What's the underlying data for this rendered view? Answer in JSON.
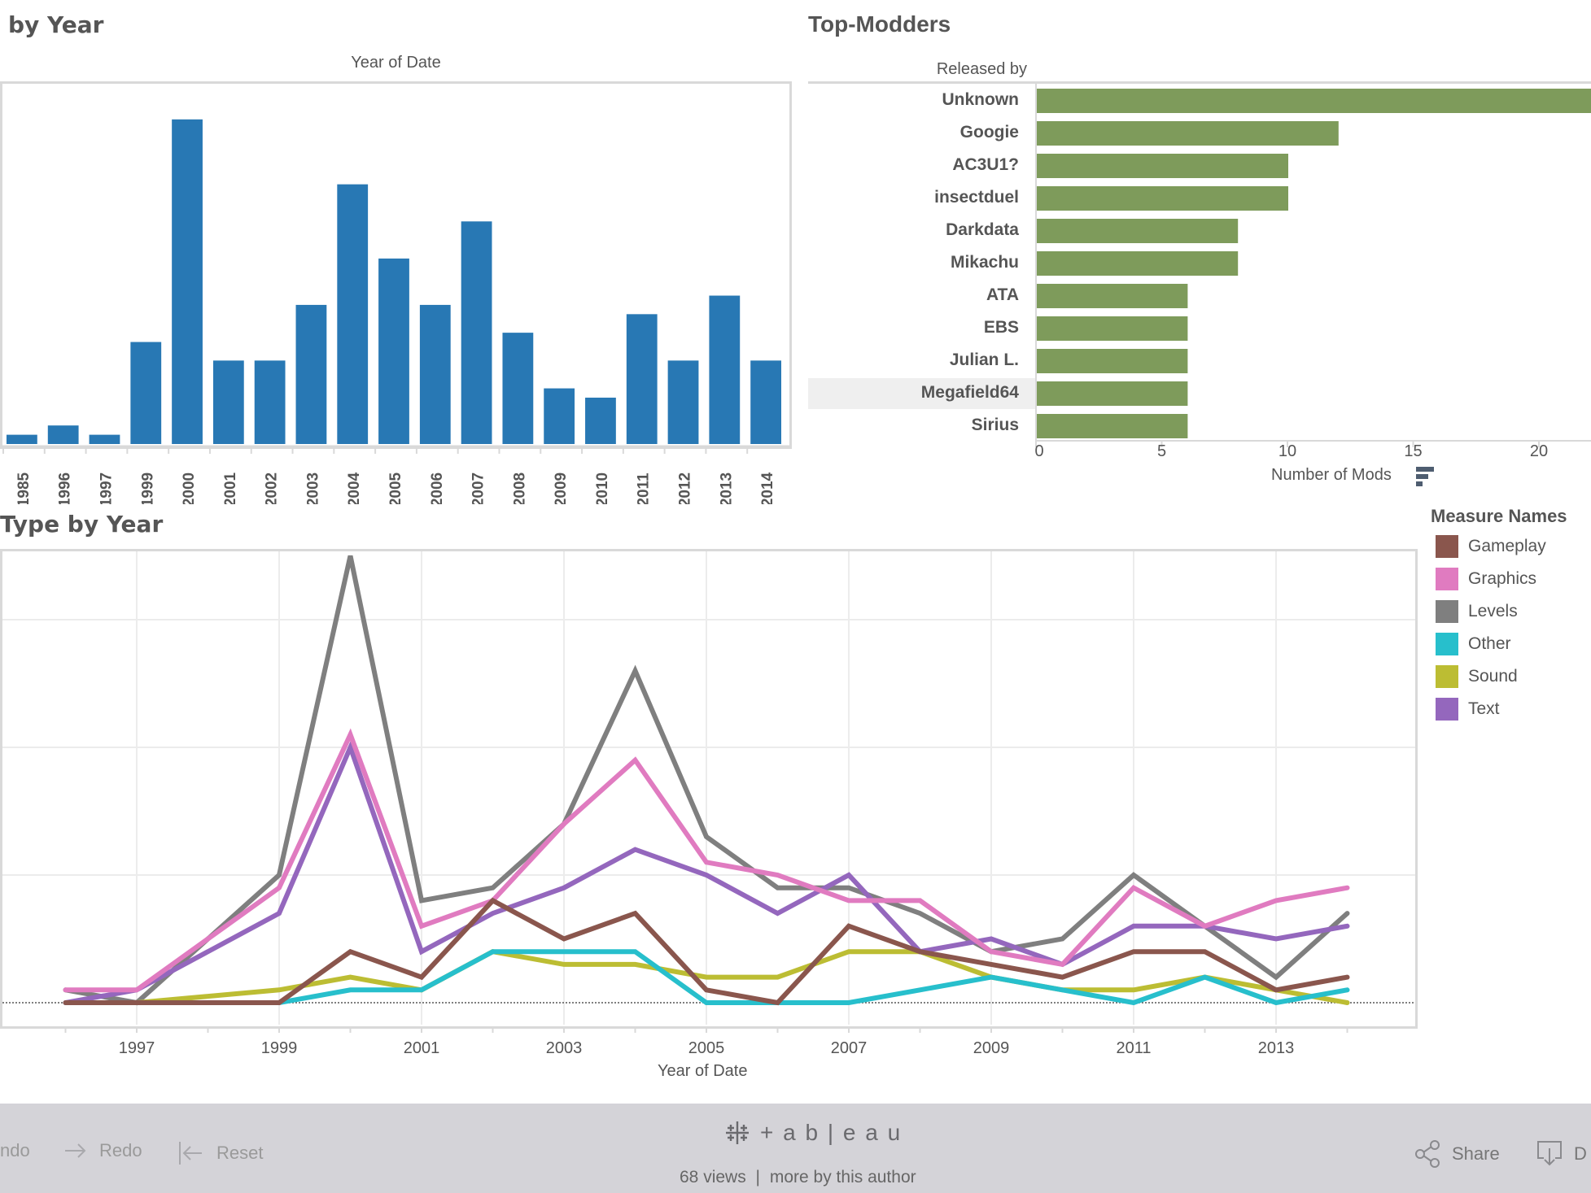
{
  "bar_by_year": {
    "title": "by Year",
    "header": "Year of Date",
    "color": "#2878b4"
  },
  "top_modders": {
    "title": "Top-Modders",
    "column_header": "Released by",
    "x_axis_title": "Number of Mods",
    "sort_icon": "sort-descending-icon",
    "color": "#7e9b5b",
    "highlighted_row": "Megafield64"
  },
  "line_by_type": {
    "title": "Type by Year",
    "x_axis_title": "Year of Date",
    "legend_title": "Measure Names"
  },
  "chart_data": [
    {
      "type": "bar",
      "title": "by Year",
      "xlabel": "Year of Date",
      "ylabel": "",
      "categories": [
        "1985",
        "1996",
        "1997",
        "1999",
        "2000",
        "2001",
        "2002",
        "2003",
        "2004",
        "2005",
        "2006",
        "2007",
        "2008",
        "2009",
        "2010",
        "2011",
        "2012",
        "2013",
        "2014"
      ],
      "values": [
        1,
        2,
        1,
        11,
        35,
        9,
        9,
        15,
        28,
        20,
        15,
        24,
        12,
        6,
        5,
        14,
        9,
        16,
        9
      ],
      "ylim": [
        0,
        37
      ],
      "grid": false
    },
    {
      "type": "bar",
      "orientation": "horizontal",
      "title": "Top-Modders",
      "xlabel": "Number of Mods",
      "ylabel": "Released by",
      "categories": [
        "Unknown",
        "Googie",
        "AC3U1?",
        "insectduel",
        "Darkdata",
        "Mikachu",
        "ATA",
        "EBS",
        "Julian L.",
        "Megafield64",
        "Sirius"
      ],
      "values": [
        23,
        12,
        10,
        10,
        8,
        8,
        6,
        6,
        6,
        6,
        6
      ],
      "xticks": [
        "0",
        "5",
        "10",
        "15",
        "20"
      ],
      "xlim": [
        0,
        22
      ]
    },
    {
      "type": "line",
      "title": "Type by Year",
      "xlabel": "Year of Date",
      "ylabel": "",
      "x": [
        1996,
        1997,
        1999,
        2000,
        2001,
        2002,
        2003,
        2004,
        2005,
        2006,
        2007,
        2008,
        2009,
        2010,
        2011,
        2012,
        2013,
        2014
      ],
      "xticks": [
        "1997",
        "1999",
        "2001",
        "2003",
        "2005",
        "2007",
        "2009",
        "2011",
        "2013"
      ],
      "xlim": [
        1995,
        2015
      ],
      "ylim": [
        0,
        37
      ],
      "grid": true,
      "legend": "right",
      "series": [
        {
          "name": "Gameplay",
          "color": "#8a564d",
          "values": [
            0,
            0,
            0,
            4,
            2,
            8,
            5,
            7,
            1,
            0,
            6,
            4,
            3,
            2,
            4,
            4,
            1,
            2
          ]
        },
        {
          "name": "Graphics",
          "color": "#e07bc0",
          "values": [
            1,
            1,
            9,
            21,
            6,
            8,
            14,
            19,
            11,
            10,
            8,
            8,
            4,
            3,
            9,
            6,
            8,
            9
          ]
        },
        {
          "name": "Levels",
          "color": "#7f7f7f",
          "values": [
            1,
            0,
            10,
            35,
            8,
            9,
            14,
            26,
            13,
            9,
            9,
            7,
            4,
            5,
            10,
            6,
            2,
            7
          ]
        },
        {
          "name": "Other",
          "color": "#27bfcc",
          "values": [
            0,
            0,
            0,
            1,
            1,
            4,
            4,
            4,
            0,
            0,
            0,
            1,
            2,
            1,
            0,
            2,
            0,
            1
          ]
        },
        {
          "name": "Sound",
          "color": "#bcbd33",
          "values": [
            0,
            0,
            1,
            2,
            1,
            4,
            3,
            3,
            2,
            2,
            4,
            4,
            2,
            1,
            1,
            2,
            1,
            0
          ]
        },
        {
          "name": "Text",
          "color": "#9467bd",
          "values": [
            0,
            1,
            7,
            20,
            4,
            7,
            9,
            12,
            10,
            7,
            10,
            4,
            5,
            3,
            6,
            6,
            5,
            6
          ]
        }
      ]
    }
  ],
  "footer": {
    "undo_label": "ndo",
    "redo_label": "Redo",
    "reset_label": "Reset",
    "brand": "+ a b | e a u",
    "views": "68 views",
    "separator": "|",
    "more_by_author": "more by this author",
    "share_label": "Share",
    "download_label": "D"
  }
}
